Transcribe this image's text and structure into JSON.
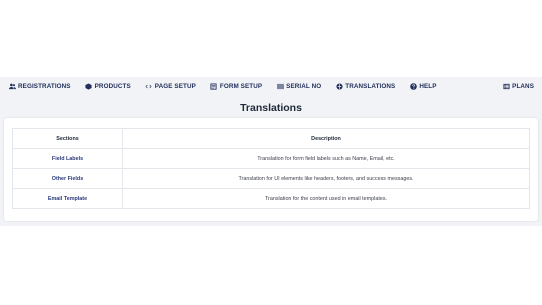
{
  "nav": {
    "items": [
      {
        "label": "REGISTRATIONS",
        "icon": "users-icon"
      },
      {
        "label": "PRODUCTS",
        "icon": "box-icon"
      },
      {
        "label": "PAGE SETUP",
        "icon": "code-icon"
      },
      {
        "label": "FORM SETUP",
        "icon": "form-icon"
      },
      {
        "label": "SERIAL NO",
        "icon": "barcode-icon"
      },
      {
        "label": "TRANSLATIONS",
        "icon": "globe-icon"
      },
      {
        "label": "HELP",
        "icon": "question-icon"
      }
    ],
    "plans": {
      "label": "PLANS",
      "icon": "list-icon"
    }
  },
  "page": {
    "title": "Translations"
  },
  "table": {
    "headers": [
      "Sections",
      "Description"
    ],
    "rows": [
      {
        "section": "Field Labels",
        "description": "Translation for form field labels such as Name, Email, etc."
      },
      {
        "section": "Other Fields",
        "description": "Translation for UI elements like headers, footers, and success messages."
      },
      {
        "section": "Email Template",
        "description": "Translation for the content used in email templates."
      }
    ]
  },
  "colors": {
    "nav_text": "#23305c",
    "panel_bg": "#f1f3f6",
    "section_text": "#2b3a7a"
  }
}
